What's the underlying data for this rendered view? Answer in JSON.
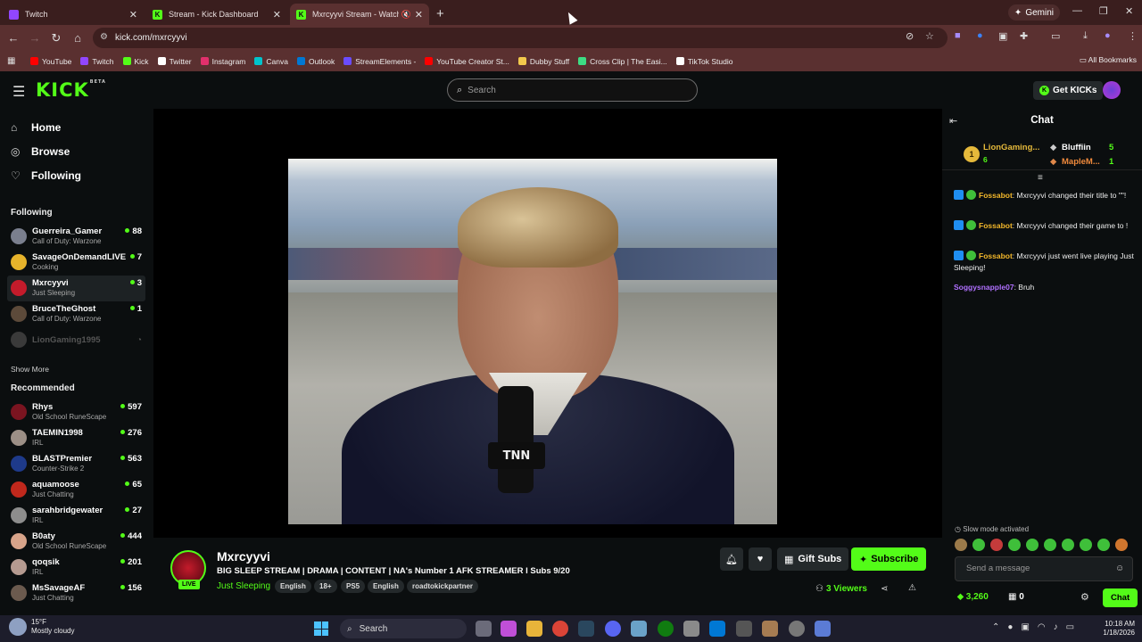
{
  "browser": {
    "tabs": [
      {
        "title": "Twitch",
        "color": "#9146ff"
      },
      {
        "title": "Stream - Kick Dashboard",
        "color": "#53fc18"
      },
      {
        "title": "Mxrcyyvi Stream - Watch Li",
        "color": "#53fc18"
      }
    ],
    "gemini_label": "Gemini",
    "url": "kick.com/mxrcyyvi",
    "bookmarks": [
      {
        "label": "YouTube",
        "color": "#ff0000"
      },
      {
        "label": "Twitch",
        "color": "#9146ff"
      },
      {
        "label": "Kick",
        "color": "#53fc18"
      },
      {
        "label": "Twitter",
        "color": "#ffffff"
      },
      {
        "label": "Instagram",
        "color": "#e1306c"
      },
      {
        "label": "Canva",
        "color": "#00c4cc"
      },
      {
        "label": "Outlook",
        "color": "#0078d4"
      },
      {
        "label": "StreamElements -",
        "color": "#6a4cff"
      },
      {
        "label": "YouTube Creator St...",
        "color": "#ff0000"
      },
      {
        "label": "Dubby Stuff",
        "color": "#f2c94c"
      },
      {
        "label": "Cross Clip | The Easi...",
        "color": "#3ddc84"
      },
      {
        "label": "TikTok Studio",
        "color": "#ffffff"
      }
    ],
    "all_bookmarks": "All Bookmarks"
  },
  "header": {
    "logo": "KICK",
    "logo_badge": "BETA",
    "search_placeholder": "Search",
    "get_kicks": "Get KICKs"
  },
  "sidebar": {
    "nav": [
      {
        "label": "Home",
        "icon": "home-icon"
      },
      {
        "label": "Browse",
        "icon": "compass-icon"
      },
      {
        "label": "Following",
        "icon": "heart-icon"
      }
    ],
    "following_title": "Following",
    "following": [
      {
        "name": "Guerreira_Gamer",
        "category": "Call of Duty: Warzone",
        "viewers": "88",
        "color": "#7a7f8e"
      },
      {
        "name": "SavageOnDemandLIVE",
        "category": "Cooking",
        "viewers": "7",
        "color": "#e6b32b"
      },
      {
        "name": "Mxrcyyvi",
        "category": "Just Sleeping",
        "viewers": "3",
        "color": "#c41b2b"
      },
      {
        "name": "BruceTheGhost",
        "category": "Call of Duty: Warzone",
        "viewers": "1",
        "color": "#5c4a3a"
      },
      {
        "name": "LionGaming1995",
        "category": "",
        "viewers": "",
        "color": "#3a3a3a"
      }
    ],
    "show_more": "Show More",
    "recommended_title": "Recommended",
    "recommended": [
      {
        "name": "Rhys",
        "category": "Old School RuneScape",
        "viewers": "597",
        "color": "#7a1420"
      },
      {
        "name": "TAEMIN1998",
        "category": "IRL",
        "viewers": "276",
        "color": "#9c8f86"
      },
      {
        "name": "BLASTPremier",
        "category": "Counter-Strike 2",
        "viewers": "563",
        "color": "#1e3a8a"
      },
      {
        "name": "aquamoose",
        "category": "Just Chatting",
        "viewers": "65",
        "color": "#c0281c"
      },
      {
        "name": "sarahbridgewater",
        "category": "IRL",
        "viewers": "27",
        "color": "#8d8d8d"
      },
      {
        "name": "B0aty",
        "category": "Old School RuneScape",
        "viewers": "444",
        "color": "#d8a48a"
      },
      {
        "name": "qoqsik",
        "category": "IRL",
        "viewers": "201",
        "color": "#b59a90"
      },
      {
        "name": "MsSavageAF",
        "category": "Just Chatting",
        "viewers": "156",
        "color": "#6b5a4e"
      }
    ]
  },
  "stream": {
    "live_badge": "LIVE",
    "name": "Mxrcyyvi",
    "title": "BIG SLEEP STREAM | DRAMA | CONTENT | NA's Number 1 AFK STREAMER  l Subs 9/20",
    "category": "Just Sleeping",
    "tags": [
      "English",
      "18+",
      "PS5",
      "English",
      "roadtokickpartner"
    ],
    "gift_subs": "Gift Subs",
    "subscribe": "Subscribe",
    "viewers": "3 Viewers",
    "video_logo": "TNN"
  },
  "chat": {
    "title": "Chat",
    "leaderboard": [
      {
        "rank": "1",
        "name": "LionGaming...",
        "count": "6"
      },
      {
        "name": "Bluffiin",
        "count": "5"
      },
      {
        "name": "MapleM...",
        "count": "1"
      }
    ],
    "messages": [
      {
        "user": "Fossabot",
        "text": "Mxrcyyvi changed their title to \"\"!"
      },
      {
        "user": "Fossabot",
        "text": "Mxrcyyvi changed their game to !"
      },
      {
        "user": "Fossabot",
        "text": "Mxrcyyvi just went live playing Just Sleeping!"
      },
      {
        "user": "Soggysnapple07",
        "text": "Bruh"
      }
    ],
    "slow_mode": "Slow mode activated",
    "input_placeholder": "Send a message",
    "kicks_balance": "3,260",
    "gifts_count": "0",
    "chat_button": "Chat"
  },
  "taskbar": {
    "temperature": "15°F",
    "weather": "Mostly cloudy",
    "search": "Search",
    "time": "10:18 AM",
    "date": "1/18/2026"
  }
}
